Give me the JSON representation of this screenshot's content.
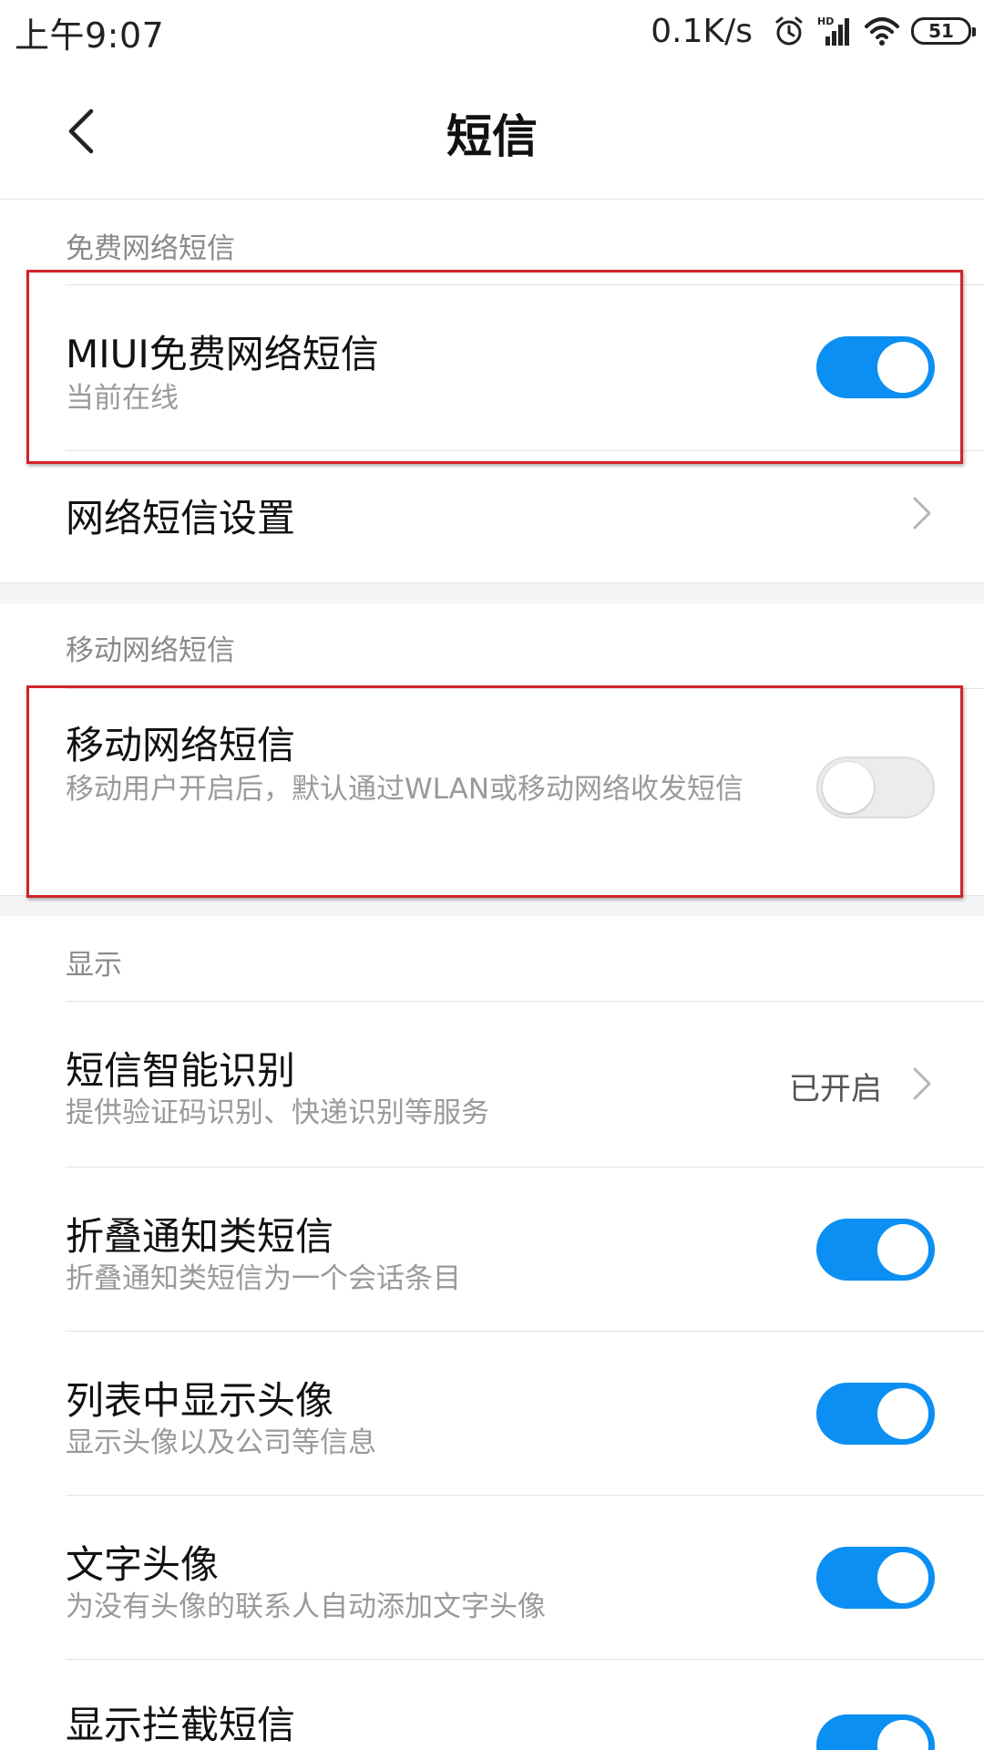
{
  "status_bar": {
    "time": "上午9:07",
    "net_speed": "0.1K/s",
    "battery_level": "51",
    "icons": [
      "alarm-icon",
      "hd-signal-icon",
      "wifi-icon",
      "battery-icon"
    ]
  },
  "header": {
    "title": "短信",
    "back_icon": "chevron-left-icon"
  },
  "sections": {
    "free_network": {
      "header": "免费网络短信",
      "miui_sms": {
        "title": "MIUI免费网络短信",
        "subtitle": "当前在线",
        "toggle": "on"
      },
      "network_settings": {
        "title": "网络短信设置"
      }
    },
    "mobile_network": {
      "header": "移动网络短信",
      "mobile_sms": {
        "title": "移动网络短信",
        "subtitle": "移动用户开启后，默认通过WLAN或移动网络收发短信",
        "toggle": "off"
      }
    },
    "display": {
      "header": "显示",
      "smart_recognition": {
        "title": "短信智能识别",
        "subtitle": "提供验证码识别、快递识别等服务",
        "value": "已开启"
      },
      "fold_notifications": {
        "title": "折叠通知类短信",
        "subtitle": "折叠通知类短信为一个会话条目",
        "toggle": "on"
      },
      "show_avatar": {
        "title": "列表中显示头像",
        "subtitle": "显示头像以及公司等信息",
        "toggle": "on"
      },
      "text_avatar": {
        "title": "文字头像",
        "subtitle": "为没有头像的联系人自动添加文字头像",
        "toggle": "on"
      },
      "show_blocked": {
        "title": "显示拦截短信",
        "toggle": "on"
      }
    }
  },
  "colors": {
    "toggle_on": "#0c8ff2",
    "toggle_off": "#ececec",
    "highlight": "#d2232a"
  }
}
